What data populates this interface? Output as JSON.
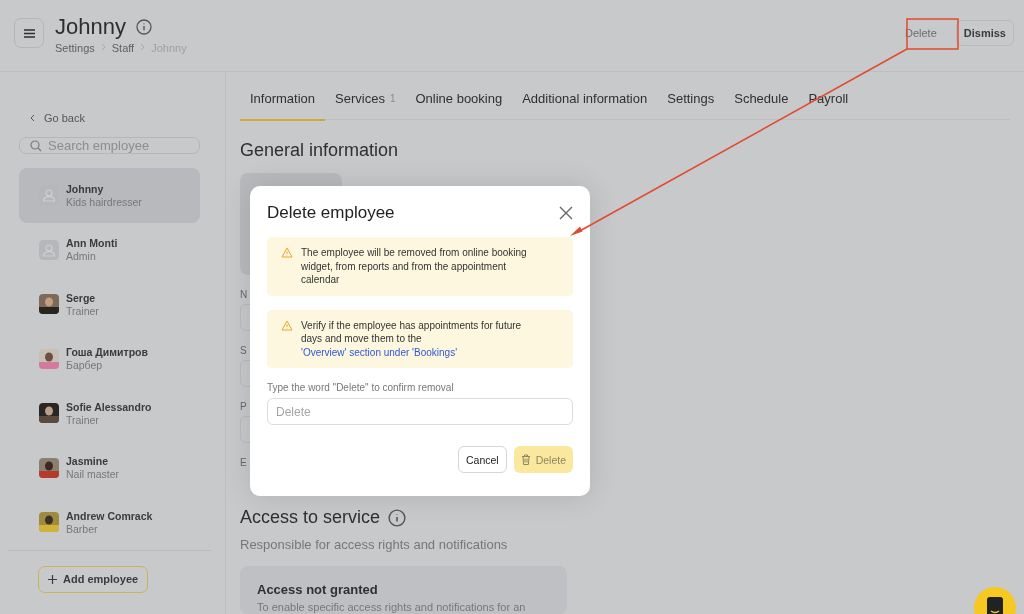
{
  "header": {
    "title": "Johnny",
    "breadcrumb": [
      "Settings",
      "Staff",
      "Johnny"
    ],
    "actions": [
      {
        "label": "Delete",
        "highlighted": true
      },
      {
        "label": "Dismiss",
        "highlighted": false
      }
    ]
  },
  "sidebar": {
    "back": "Go back",
    "search": {
      "placeholder": "Search employee"
    },
    "employees": [
      {
        "name": "Johnny",
        "role": "Kids hairdresser",
        "selected": true,
        "kind": "placeholder"
      },
      {
        "name": "Ann Monti",
        "role": "Admin",
        "selected": false,
        "kind": "placeholder"
      },
      {
        "name": "Serge",
        "role": "Trainer",
        "selected": false,
        "kind": "picture"
      },
      {
        "name": "Гоша Димитров",
        "role": "Барбер",
        "selected": false,
        "kind": "picture"
      },
      {
        "name": "Sofie Alessandro",
        "role": "Trainer",
        "selected": false,
        "kind": "picture"
      },
      {
        "name": "Jasmine",
        "role": "Nail master",
        "selected": false,
        "kind": "picture"
      },
      {
        "name": "Andrew Comrack",
        "role": "Barber",
        "selected": false,
        "kind": "picture"
      }
    ],
    "add_button": "Add employee"
  },
  "tabs": [
    {
      "label": "Information",
      "selected": true
    },
    {
      "label": "Services",
      "badge": "1",
      "selected": false
    },
    {
      "label": "Online booking",
      "selected": false
    },
    {
      "label": "Additional information",
      "selected": false
    },
    {
      "label": "Settings",
      "selected": false
    },
    {
      "label": "Schedule",
      "selected": false
    },
    {
      "label": "Payroll",
      "selected": false
    }
  ],
  "section_title": "General information",
  "field_labels": [
    "N",
    "S",
    "P",
    "E"
  ],
  "access": {
    "title": "Access to service",
    "subtitle": "Responsible for access rights and notifications",
    "card_title": "Access not granted",
    "card_text": "To enable specific access rights and notifications for an"
  },
  "dialog": {
    "title": "Delete employee",
    "notices": [
      {
        "text": "The employee will be removed from online booking widget, from reports and from the appointment calendar"
      },
      {
        "text": "Verify if the employee has appointments for future days and move them to the",
        "link": "'Overview' section under 'Bookings'"
      }
    ],
    "confirm_label": "Type the word \"Delete\" to confirm removal",
    "input": {
      "placeholder": "Delete"
    },
    "buttons": [
      {
        "label": "Cancel",
        "kind": "secondary",
        "disabled": false
      },
      {
        "label": "Delete",
        "kind": "danger",
        "disabled": true
      }
    ]
  }
}
